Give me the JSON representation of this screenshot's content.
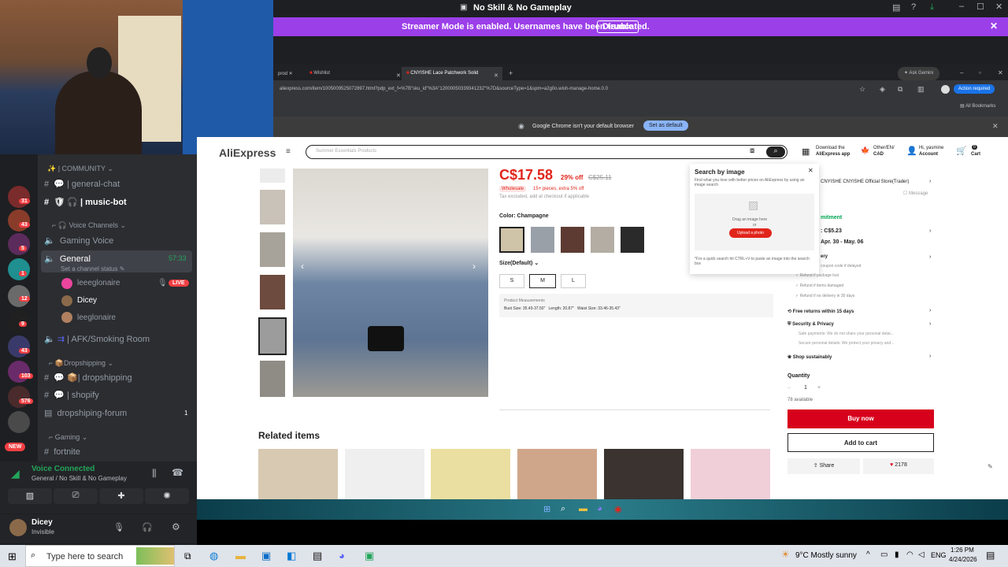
{
  "window": {
    "title": "No Skill & No Gameplay"
  },
  "streamer": {
    "message": "Streamer Mode is enabled. Usernames have been truncated.",
    "disable": "Disable"
  },
  "discord": {
    "category_community": "| COMMUNITY",
    "ch_general_chat": "| general-chat",
    "ch_music_bot": "| music-bot",
    "category_voice": "Voice Channels",
    "ch_gaming_voice": "Gaming Voice",
    "ch_general": "General",
    "general_time": "57:33",
    "general_status": "Set a channel status",
    "user1": "leeeglonaire",
    "live": "LIVE",
    "user2": "Dicey",
    "user3": "leeglonaire",
    "ch_afk": "| AFK/Smoking Room",
    "category_drop": "Dropshipping",
    "ch_dropshipping": "| dropshipping",
    "ch_shopify": "| shopify",
    "ch_forum": "dropshiping-forum",
    "forum_count": "1",
    "category_gaming": "Gaming",
    "ch_fortnite": "fortnite",
    "voice_connected": "Voice Connected",
    "voice_channel": "General / No Skill & No Gameplay",
    "username": "Dicey",
    "user_status": "Invisible",
    "badges": [
      "31",
      "43",
      "5",
      "1",
      "12",
      "9",
      "43",
      "103",
      "576",
      "NEW"
    ]
  },
  "browser": {
    "tabs": [
      "prod",
      "Wishlist",
      "CNYISHE Lace Patchwork Solid"
    ],
    "ask_gemini": "Ask Gemini",
    "url": "aliexpress.com/item/1005009525072897.html?pdp_ext_f=%7B\"sku_id\"%3A\"12000050339341232\"%7D&sourceType=1&spm=a2g0o.wish-manage-home.0.0",
    "action_required": "Action required",
    "all_bookmarks": "All Bookmarks",
    "default_msg": "Google Chrome isn't your default browser",
    "set_default": "Set as default"
  },
  "ali": {
    "logo": "AliExpress",
    "search_placeholder": "Summer Essentials Products",
    "download1": "Download the",
    "download2": "AliExpress app",
    "region1": "Other/EN/",
    "region2": "CAD",
    "hi": "Hi, yasmine",
    "account": "Account",
    "cart": "Cart",
    "cart_count": "0",
    "price": "C$17.58",
    "discount": "29% off",
    "old_price": "C$25.11",
    "wholesale": "Wholesale",
    "wholesale_note": "15+ pieces, extra 5% off",
    "tax": "Tax excluded, add at checkout if applicable",
    "color_label": "Color: Champagne",
    "size_label": "Size(Default)",
    "sizes": [
      "S",
      "M",
      "L"
    ],
    "measure_title": "Product Measurements",
    "measure_line": "Bust Size: 35.43-37.50\"   Length: 20.87\"   Waist Size: 33.46-35.43\"",
    "related": "Related items",
    "search_by_image": "Search by image",
    "sbi_desc": "Find what you love with better prices on AliExpress by using an image search",
    "drag": "Drag an image here",
    "or": "or",
    "upload": "Upload a photo",
    "sbi_tip": "*For a quick search hit CTRL+V to paste an image into the search box",
    "store": "CNYISHE CNYISHE Official Store(Trader)",
    "message": "Message",
    "commitment": "mitment",
    "ship_price": ": C$5.23",
    "ship_date": "Apr. 30 - May. 06",
    "delivery": "ery",
    "coupon": "coupon code if delayed",
    "refund1": "Refund if package lost",
    "refund2": "Refund if items damaged",
    "refund3": "Refund if no delivery in 30 days",
    "free_returns": "Free returns within 15 days",
    "security": "Security & Privacy",
    "safe_pay": "Safe payments: We do not share your personal detai...",
    "secure_data": "Secure personal details: We protect your privacy and...",
    "sustain": "Shop sustainably",
    "quantity": "Quantity",
    "qty": "1",
    "available": "78 available",
    "buy": "Buy now",
    "add_cart": "Add to cart",
    "share": "Share",
    "likes": "2178"
  },
  "taskbar": {
    "search": "Type here to search",
    "weather": "9°C  Mostly sunny",
    "lang": "ENG",
    "time": "1:26 PM",
    "date": "4/24/2026"
  },
  "colors": {
    "accent": "#9b3fe9",
    "ali_red": "#e1251b",
    "buy": "#d7011c"
  }
}
